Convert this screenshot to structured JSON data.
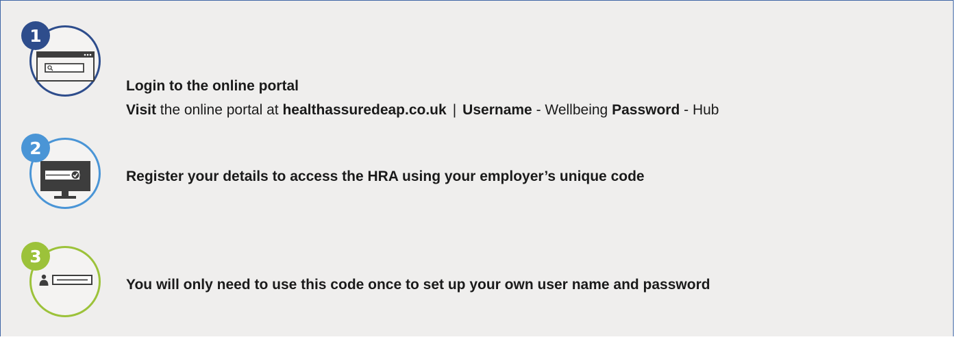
{
  "steps": [
    {
      "number": "1",
      "color": "#2e4d8c",
      "icon": "browser-search-icon",
      "title": "Login to the online portal",
      "visit_label": "Visit",
      "visit_text": " the online portal at ",
      "url": "healthassuredeap.co.uk",
      "separator": "|",
      "username_label": "Username",
      "username_value": " - Wellbeing ",
      "password_label": "Password",
      "password_value": " - Hub"
    },
    {
      "number": "2",
      "color": "#4a95d6",
      "icon": "monitor-check-icon",
      "text": "Register your details to access the HRA using your employer’s unique code"
    },
    {
      "number": "3",
      "color": "#9cc23a",
      "icon": "user-field-icon",
      "text": "You will only need to use this code once to set up your own user name and password"
    }
  ]
}
